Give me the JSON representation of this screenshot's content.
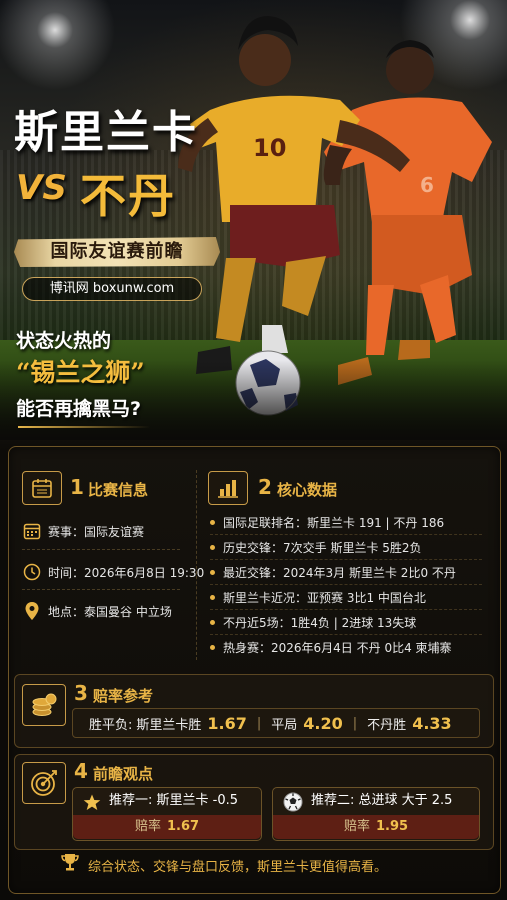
{
  "hero": {
    "title_team_a": "斯里兰卡",
    "vs": "VS",
    "title_team_b": "不丹",
    "subtitle": "国际友谊赛前瞻",
    "site": "博讯网 boxunw.com",
    "slogan_line1": "状态火热的",
    "slogan_line2": "“锡兰之狮”",
    "slogan_line3": "能否再擒黑马?",
    "jersey_a_number": "10",
    "jersey_b_number": "6"
  },
  "match_info": {
    "number": "1",
    "title": "比赛信息",
    "event": "赛事：国际友谊赛",
    "time": "时间：2026年6月8日 19:30",
    "venue": "地点：泰国曼谷 中立场"
  },
  "core_data": {
    "number": "2",
    "title": "核心数据",
    "items": [
      "国际足联排名：斯里兰卡 191 | 不丹 186",
      "历史交锋：7次交手 斯里兰卡 5胜2负",
      "最近交锋：2024年3月 斯里兰卡 2比0 不丹",
      "斯里兰卡近况：亚预赛 3比1 中国台北",
      "不丹近5场：1胜4负 | 2进球 13失球",
      "热身赛：2026年6月4日 不丹 0比4 柬埔寨"
    ]
  },
  "odds": {
    "number": "3",
    "title": "赔率参考",
    "label": "胜平负:",
    "home_label": "斯里兰卡胜",
    "home_value": "1.67",
    "draw_label": "平局",
    "draw_value": "4.20",
    "away_label": "不丹胜",
    "away_value": "4.33",
    "separator": "|"
  },
  "outlook": {
    "number": "4",
    "title": "前瞻观点",
    "rec1_title": "推荐一: 斯里兰卡 -0.5",
    "rec1_odds_label": "赔率",
    "rec1_odds": "1.67",
    "rec2_title": "推荐二: 总进球 大于 2.5",
    "rec2_odds_label": "赔率",
    "rec2_odds": "1.95"
  },
  "footer": "综合状态、交锋与盘口反馈，斯里兰卡更值得高看。",
  "colors": {
    "accent": "#e8b446",
    "dark_bg": "#0c0906",
    "odds_bar": "#5e1f14"
  }
}
